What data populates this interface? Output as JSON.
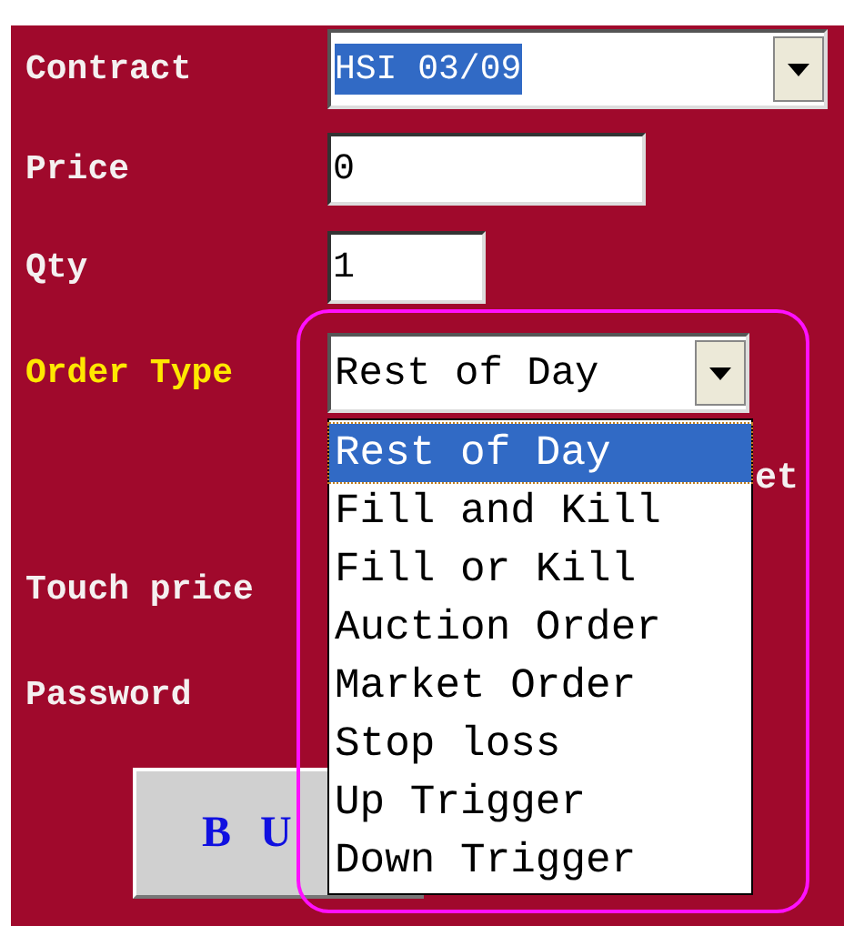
{
  "form": {
    "fields": [
      {
        "label": "Contract",
        "kind": "combo",
        "value": "HSI 03/09",
        "text_selected": true,
        "active": false
      },
      {
        "label": "Price",
        "kind": "text",
        "value": "0",
        "active": false
      },
      {
        "label": "Qty",
        "kind": "text",
        "value": "1",
        "active": false
      },
      {
        "label": "Order Type",
        "kind": "combo",
        "value": "Rest of Day",
        "text_selected": false,
        "active": true
      },
      {
        "label": "et",
        "kind": "trailing_label",
        "active": false
      },
      {
        "label": "Touch price",
        "kind": "label",
        "active": false
      },
      {
        "label": "Password",
        "kind": "label",
        "active": false
      }
    ],
    "buttons": [
      {
        "label": "B U"
      }
    ],
    "dropdown": {
      "options": [
        {
          "label": "Rest of Day",
          "selected": true
        },
        {
          "label": "Fill and Kill",
          "selected": false
        },
        {
          "label": "Fill or Kill",
          "selected": false
        },
        {
          "label": "Auction Order",
          "selected": false
        },
        {
          "label": "Market Order",
          "selected": false
        },
        {
          "label": "Stop loss",
          "selected": false
        },
        {
          "label": "Up Trigger",
          "selected": false
        },
        {
          "label": "Down Trigger",
          "selected": false
        }
      ]
    },
    "annotation": {
      "kind": "outline"
    }
  }
}
